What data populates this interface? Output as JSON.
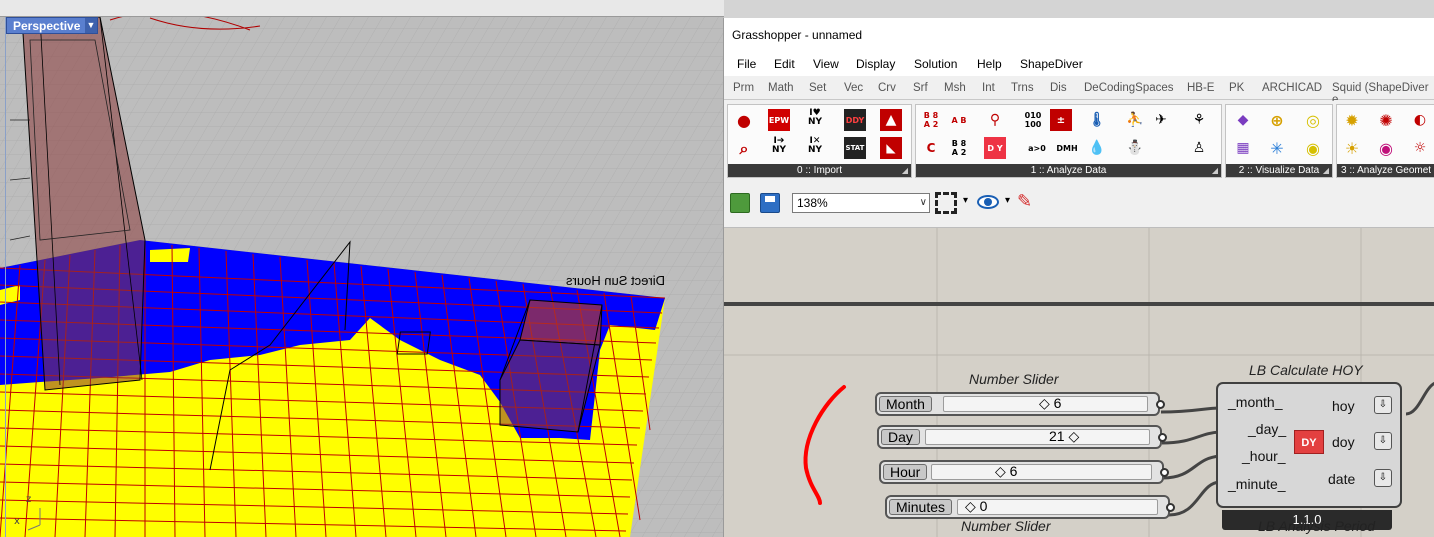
{
  "viewport": {
    "name": "Perspective",
    "annotation": "Direct Sun Hours",
    "axis_x": "x",
    "axis_z": "z"
  },
  "gh": {
    "title": "Grasshopper - unnamed",
    "menu": [
      "File",
      "Edit",
      "View",
      "Display",
      "Solution",
      "Help",
      "ShapeDiver"
    ],
    "tabs": [
      "Prm",
      "Math",
      "Set",
      "Vec",
      "Crv",
      "Srf",
      "Msh",
      "Int",
      "Trns",
      "Dis",
      "DeCodingSpaces",
      "HB-E",
      "PK",
      "ARCHICAD",
      "Squid (ShapeDiver e"
    ],
    "panels": [
      "0 :: Import",
      "1 :: Analyze Data",
      "2 :: Visualize Data",
      "3 :: Analyze Geomet"
    ],
    "ribbon_text": {
      "epw": "EPW",
      "iny1": "I♥ NY",
      "ddy": "DDY",
      "iny2": "I➔ NY",
      "iny3": "I✕ NY",
      "stat": "STAT",
      "b8a2": "B 8 A 2",
      "ab": "A B",
      "c": "C",
      "b8a2b": "B 8 A 2",
      "dy": "D Y",
      "bin": "010 100",
      "agt0": "a>0",
      "dmh": "DMH"
    },
    "zoom": "138%",
    "canvas": {
      "top_caption": "Number Slider",
      "bottom_caption": "Number Slider",
      "sliders": [
        {
          "label": "Month",
          "value": "6"
        },
        {
          "label": "Day",
          "value": "21"
        },
        {
          "label": "Hour",
          "value": "6"
        },
        {
          "label": "Minutes",
          "value": "0"
        }
      ],
      "component": {
        "title": "LB Calculate HOY",
        "inputs": [
          "_month_",
          "_day_",
          "_hour_",
          "_minute_"
        ],
        "outputs": [
          "hoy",
          "doy",
          "date"
        ],
        "icon_text": "DY",
        "version": "1.1.0",
        "below_caption": "LB Analysis Period"
      }
    }
  },
  "colors": {
    "sun": "#ffff00",
    "shade": "#0000ff",
    "grid_line": "#c00000",
    "annotation": "#ff0000"
  }
}
